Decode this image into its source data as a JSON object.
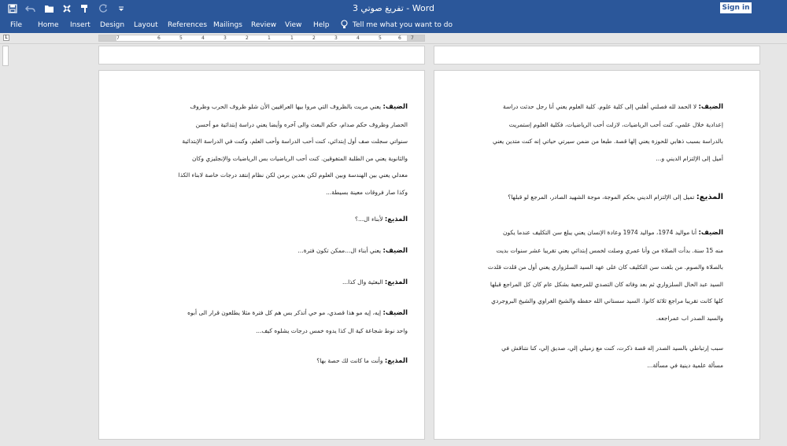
{
  "window": {
    "title": "تفريغ صوتي 3  -  Word",
    "sign_in": "Sign in",
    "qat_icons": [
      "save-icon",
      "undo-icon",
      "open-icon",
      "format-painter-icon",
      "paint-brush-icon",
      "redo-icon",
      "customize-qat-icon"
    ]
  },
  "ribbon": {
    "tabs": [
      "File",
      "Home",
      "Insert",
      "Design",
      "Layout",
      "References",
      "Mailings",
      "Review",
      "View",
      "Help"
    ],
    "tell_me": "Tell me what you want to do"
  },
  "ruler": {
    "ticks": [
      "7",
      "6",
      "5",
      "4",
      "3",
      "2",
      "1",
      "1",
      "2",
      "3",
      "4",
      "5",
      "6",
      "7"
    ]
  },
  "left_page": {
    "paragraphs": [
      {
        "label": "الضيف:",
        "lines": [
          "يعني مريت بالظروف التي مروا بيها العراقيين الأن شلو ظروف الحرب وظروف",
          "الحصار وظروف حكم صدام، حكم البعث والى آخره وأيضا يعني دراسة إبتدائية مو أحسن",
          "سنواتي سجلت صف أول إبتدائي، كنت أحب الدراسة وأحب العلم، وكنت في الدراسة الإبتدائية",
          "والثانوية يعني من الطلبة المتفوقين. كنت أحب الرياضيات بس الرياضيات والإنجليزي وكان",
          "معدلي يعني بين الهندسة وبين العلوم لكن بعدين برمن لكن نظام إنتقد درجات خاصة لابناء الكذا",
          "وكذا صار فروقات معينة بسيطة..."
        ]
      },
      {
        "label": "المذيع:",
        "lines": [
          "لأبناء ال...؟"
        ]
      },
      {
        "label": "الضيف:",
        "lines": [
          "يعني أبناء ال...ممكن تكون فترة..."
        ]
      },
      {
        "label": "المذيع:",
        "lines": [
          "البعثية وال كذا..."
        ]
      },
      {
        "label": "الضيف:",
        "lines": [
          "إيه، إيه مو هذا قصدي، مو حي أتذكر بس هم كل فترة مثلا يطلعون قرار الى أبوه",
          "واحد نوط شجاعة كية ال كذا يدوه خمس درجات يشلوه كيف..."
        ]
      },
      {
        "label": "المذيع:",
        "lines": [
          "وأنت ما كانت لك حصة بها؟"
        ]
      }
    ]
  },
  "right_page": {
    "paragraphs": [
      {
        "label": "الضيف:",
        "lines": [
          "لا الحمد لله فصلني أهلني إلى كلية علوم. كلية العلوم يعني أنا رجل حدثت دراسة",
          "إعدادية خلال علمي، كنت أحب الرياضيات، لازلت أحب الرياضيات، فكلية العلوم إستمريت",
          "بالدراسة بسبب ذهابي للحوزة يعني إلها قصة. طبعا من ضمن سيرتي حياتي إنه كنت متدين يعني",
          "أميل إلى الإلتزام الديني و..."
        ]
      },
      {
        "label": "المذيع:",
        "big": true,
        "lines": [
          "تميل إلى الإلتزام الديني بحكم الموجة، موجة الشهيد الصادر، المرجع لو قبلها؟"
        ]
      },
      {
        "label": "الضيف:",
        "lines": [
          "أنا مواليد 1974، مواليد 1974 وعادة الإنسان يعني يبلغ سن التكليف عندما يكون",
          "منه 15 سنة. بدأت الصلاة من وأنا عمري وصلت لخمس إبتدائي يعني تقريبا عشر سنوات بديت",
          "بالصلاة والصوم. من بلغت سن التكليف كان على عهد السيد السلزواري يعني أول من قلدت قلدت",
          "السيد عبد الحال السلزواري ثم بعد وفاته كان التصدي للمرجعية بشكل عام كان كل المراجع قبلها",
          "كلها كانت تقريبا مراجع ثلاثة كانوا. السيد سستاني الله حفظه والشيخ الغراوي والشيخ البروجردي",
          "والسيد الصدر اب عمراجعه."
        ]
      },
      {
        "label": "",
        "lines": [
          "سبب إرتباطي بالسيد الصدر إله قصة ذكرت، كنت مع زميلي إلي، صديق إلي، كنا نتناقش في",
          "مسألة علمية دينية في مسألة..."
        ]
      }
    ]
  }
}
